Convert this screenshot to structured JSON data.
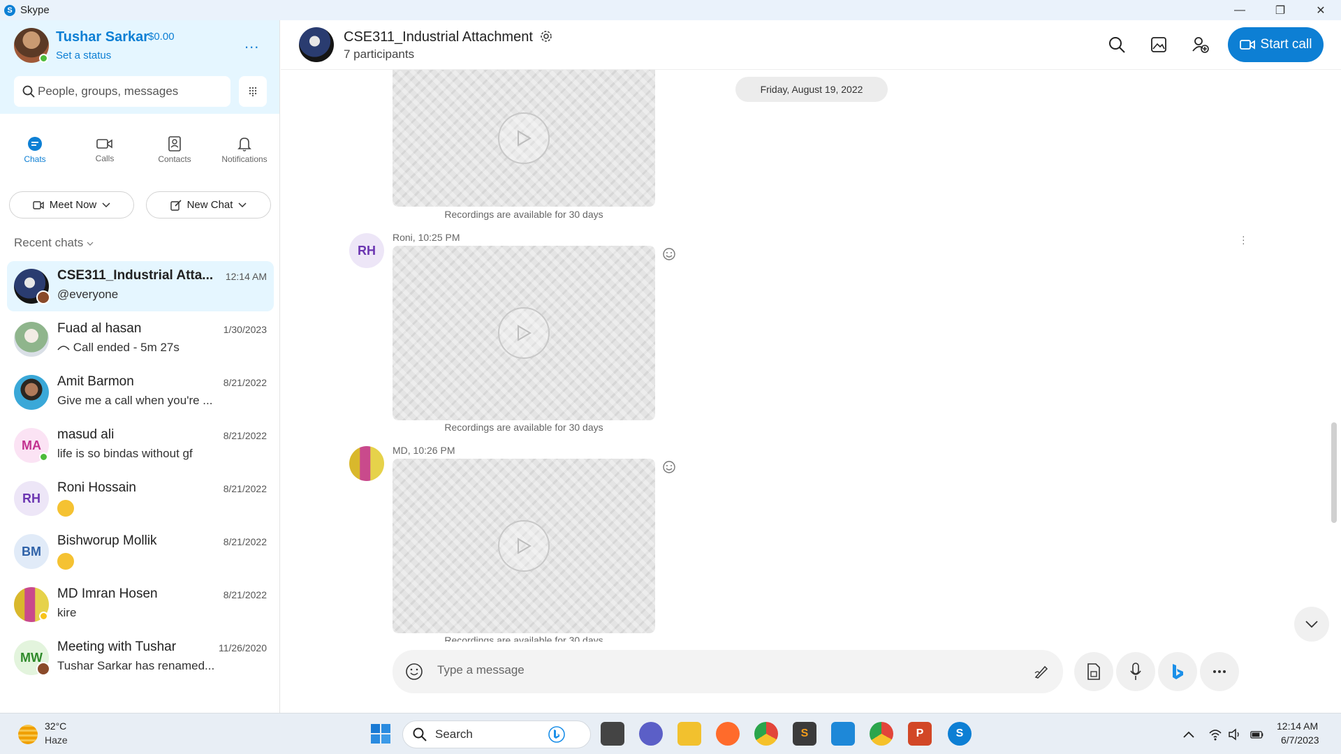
{
  "window": {
    "app_name": "Skype",
    "logo_letter": "S",
    "controls": {
      "minimize": "—",
      "restore": "❐",
      "close": "✕"
    }
  },
  "profile": {
    "name": "Tushar Sarkar",
    "credit": "$0.00",
    "status_link": "Set a status",
    "more": "..."
  },
  "search": {
    "placeholder": "People, groups, messages"
  },
  "nav": {
    "tabs": [
      {
        "label": "Chats",
        "icon": "chat-icon",
        "active": true
      },
      {
        "label": "Calls",
        "icon": "video-icon",
        "active": false
      },
      {
        "label": "Contacts",
        "icon": "contacts-icon",
        "active": false
      },
      {
        "label": "Notifications",
        "icon": "bell-icon",
        "active": false
      }
    ]
  },
  "actions": {
    "meet_now": "Meet Now",
    "new_chat": "New Chat"
  },
  "recent": {
    "header": "Recent chats"
  },
  "chats": [
    {
      "name": "CSE311_Industrial Atta...",
      "date": "12:14 AM",
      "preview": "@everyone",
      "initials": "",
      "active": true
    },
    {
      "name": "Fuad al hasan",
      "date": "1/30/2023",
      "preview": "Call ended - 5m 27s",
      "initials": ""
    },
    {
      "name": "Amit Barmon",
      "date": "8/21/2022",
      "preview": "Give me a call when you're ...",
      "initials": ""
    },
    {
      "name": "masud ali",
      "date": "8/21/2022",
      "preview": "life is so bindas without gf",
      "initials": "MA"
    },
    {
      "name": "Roni Hossain",
      "date": "8/21/2022",
      "preview": "",
      "initials": "RH"
    },
    {
      "name": "Bishworup Mollik",
      "date": "8/21/2022",
      "preview": "",
      "initials": "BM"
    },
    {
      "name": "MD Imran Hosen",
      "date": "8/21/2022",
      "preview": "kire",
      "initials": ""
    },
    {
      "name": "Meeting with Tushar",
      "date": "11/26/2020",
      "preview": "Tushar Sarkar has renamed...",
      "initials": "MW"
    }
  ],
  "conversation": {
    "title": "CSE311_Industrial Attachment",
    "participants": "7 participants",
    "start_call": "Start call",
    "date_divider": "Friday, August 19, 2022",
    "recording_note": "Recordings are available for 30 days",
    "messages": [
      {
        "sender_initials": "RH",
        "meta": "Roni, 10:25 PM"
      },
      {
        "sender_initials": "",
        "meta": "MD, 10:26 PM"
      }
    ],
    "composer_placeholder": "Type a message"
  },
  "taskbar": {
    "weather_temp": "32°C",
    "weather_desc": "Haze",
    "search_label": "Search",
    "time": "12:14 AM",
    "date": "6/7/2023"
  },
  "colors": {
    "brand": "#0d7fd4",
    "sidebar_top": "#e5f6ff",
    "active_chat": "#e5f6ff"
  }
}
